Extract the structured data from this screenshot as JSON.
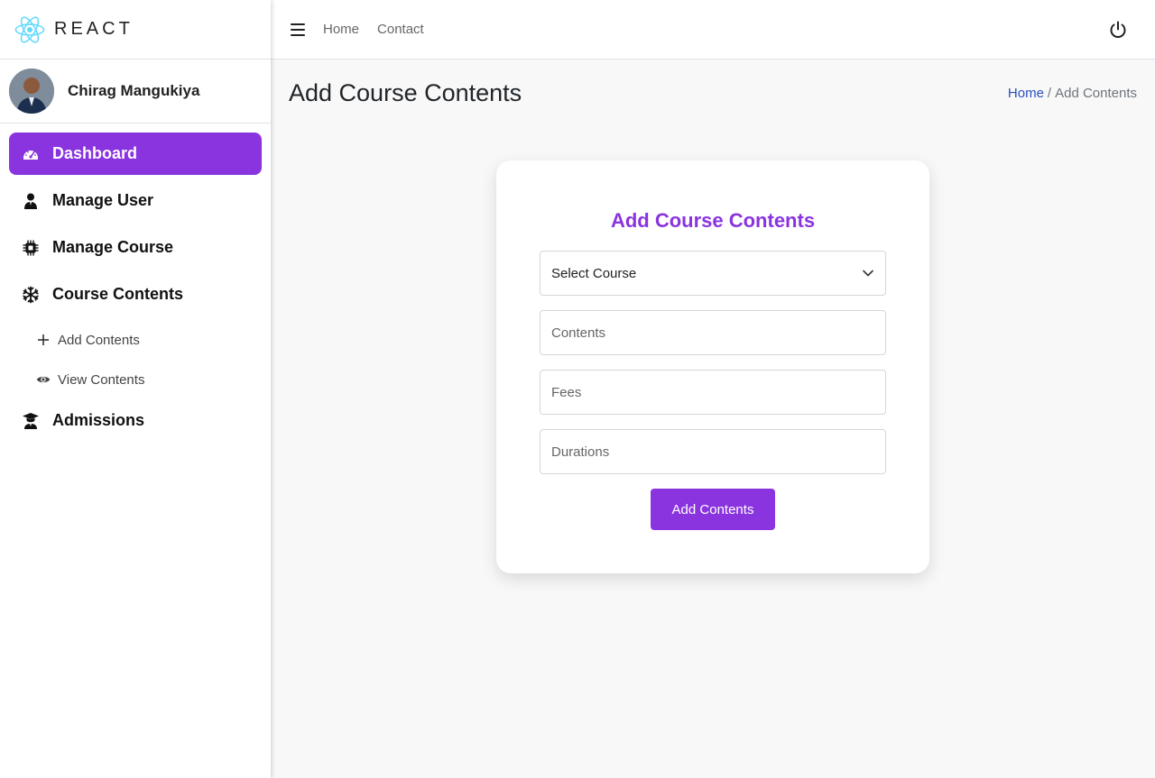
{
  "brand": {
    "name": "REACT",
    "logo_icon": "react-logo-icon",
    "logo_color": "#61dafb"
  },
  "user": {
    "name": "Chirag Mangukiya"
  },
  "sidebar": {
    "accent_color": "#8a34e0",
    "items": [
      {
        "label": "Dashboard",
        "icon": "dashboard-icon",
        "active": true
      },
      {
        "label": "Manage User",
        "icon": "user-icon"
      },
      {
        "label": "Manage Course",
        "icon": "chip-icon"
      },
      {
        "label": "Course Contents",
        "icon": "snowflake-icon"
      },
      {
        "label": "Admissions",
        "icon": "graduate-icon"
      }
    ],
    "subitems": [
      {
        "label": "Add Contents",
        "icon": "plus-icon"
      },
      {
        "label": "View Contents",
        "icon": "eye-icon"
      }
    ]
  },
  "topbar": {
    "links": [
      "Home",
      "Contact"
    ],
    "menu_icon": "hamburger-icon",
    "power_icon": "power-icon"
  },
  "page": {
    "title": "Add Course Contents",
    "breadcrumb": {
      "home": "Home",
      "separator": "/",
      "current": "Add Contents"
    }
  },
  "form": {
    "title": "Add Course Contents",
    "course_select": {
      "value": "Select Course"
    },
    "contents": {
      "placeholder": "Contents"
    },
    "fees": {
      "placeholder": "Fees"
    },
    "durations": {
      "placeholder": "Durations"
    },
    "submit_label": "Add Contents"
  }
}
